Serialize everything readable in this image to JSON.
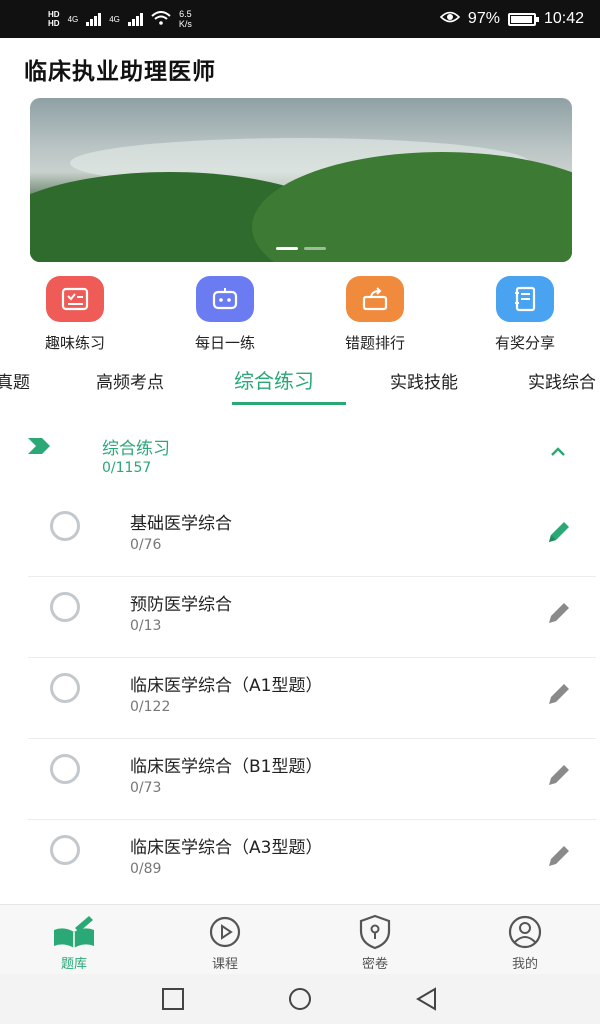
{
  "status_bar": {
    "hd1": "HD",
    "hd2": "HD",
    "net1": "4G",
    "net2": "4G",
    "speed_value": "6.5",
    "speed_unit": "K/s",
    "battery": "97%",
    "battery_level": 0.97,
    "time": "10:42"
  },
  "app": {
    "title": "临床执业助理医师"
  },
  "quick_actions": [
    {
      "label": "趣味练习",
      "icon": "quiz-icon",
      "color": "#ef5b57"
    },
    {
      "label": "每日一练",
      "icon": "robot-icon",
      "color": "#6b7cf2"
    },
    {
      "label": "错题排行",
      "icon": "share-box-icon",
      "color": "#f08a3c"
    },
    {
      "label": "有奖分享",
      "icon": "notebook-icon",
      "color": "#4aa3f0"
    }
  ],
  "tabs": [
    {
      "label": "真题"
    },
    {
      "label": "高频考点"
    },
    {
      "label": "综合练习",
      "active": true
    },
    {
      "label": "实践技能"
    },
    {
      "label": "实践综合"
    }
  ],
  "group": {
    "title": "综合练习",
    "count": "0/1157"
  },
  "items": [
    {
      "title": "基础医学综合",
      "count": "0/76"
    },
    {
      "title": "预防医学综合",
      "count": "0/13"
    },
    {
      "title": "临床医学综合（A1型题）",
      "count": "0/122"
    },
    {
      "title": "临床医学综合（B1型题）",
      "count": "0/73"
    },
    {
      "title": "临床医学综合（A3型题）",
      "count": "0/89"
    }
  ],
  "bottom_nav": [
    {
      "label": "题库",
      "active": true
    },
    {
      "label": "课程"
    },
    {
      "label": "密卷"
    },
    {
      "label": "我的"
    }
  ],
  "colors": {
    "accent": "#2aa876",
    "muted_icon": "#8a8a8a"
  }
}
